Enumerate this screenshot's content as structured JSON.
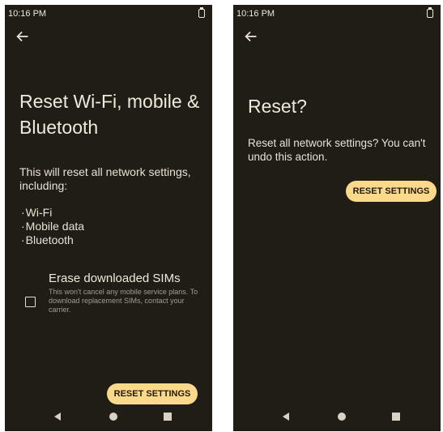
{
  "left_screen": {
    "status_time": "10:16 PM",
    "title": "Reset Wi-Fi, mobile & Bluetooth",
    "description": "This will reset all network settings, including:",
    "items": [
      "Wi-Fi",
      "Mobile data",
      "Bluetooth"
    ],
    "erase_sims": {
      "title": "Erase downloaded SIMs",
      "description": "This won't cancel any mobile service plans. To download replacement SIMs, contact your carrier.",
      "checked": false
    },
    "reset_button": "RESET SETTINGS"
  },
  "right_screen": {
    "status_time": "10:16 PM",
    "title": "Reset?",
    "message": "Reset all network settings? You can't undo this action.",
    "reset_button": "RESET SETTINGS"
  },
  "colors": {
    "background": "#201d17",
    "button": "#fbd98a",
    "text": "#ebe3d6"
  }
}
